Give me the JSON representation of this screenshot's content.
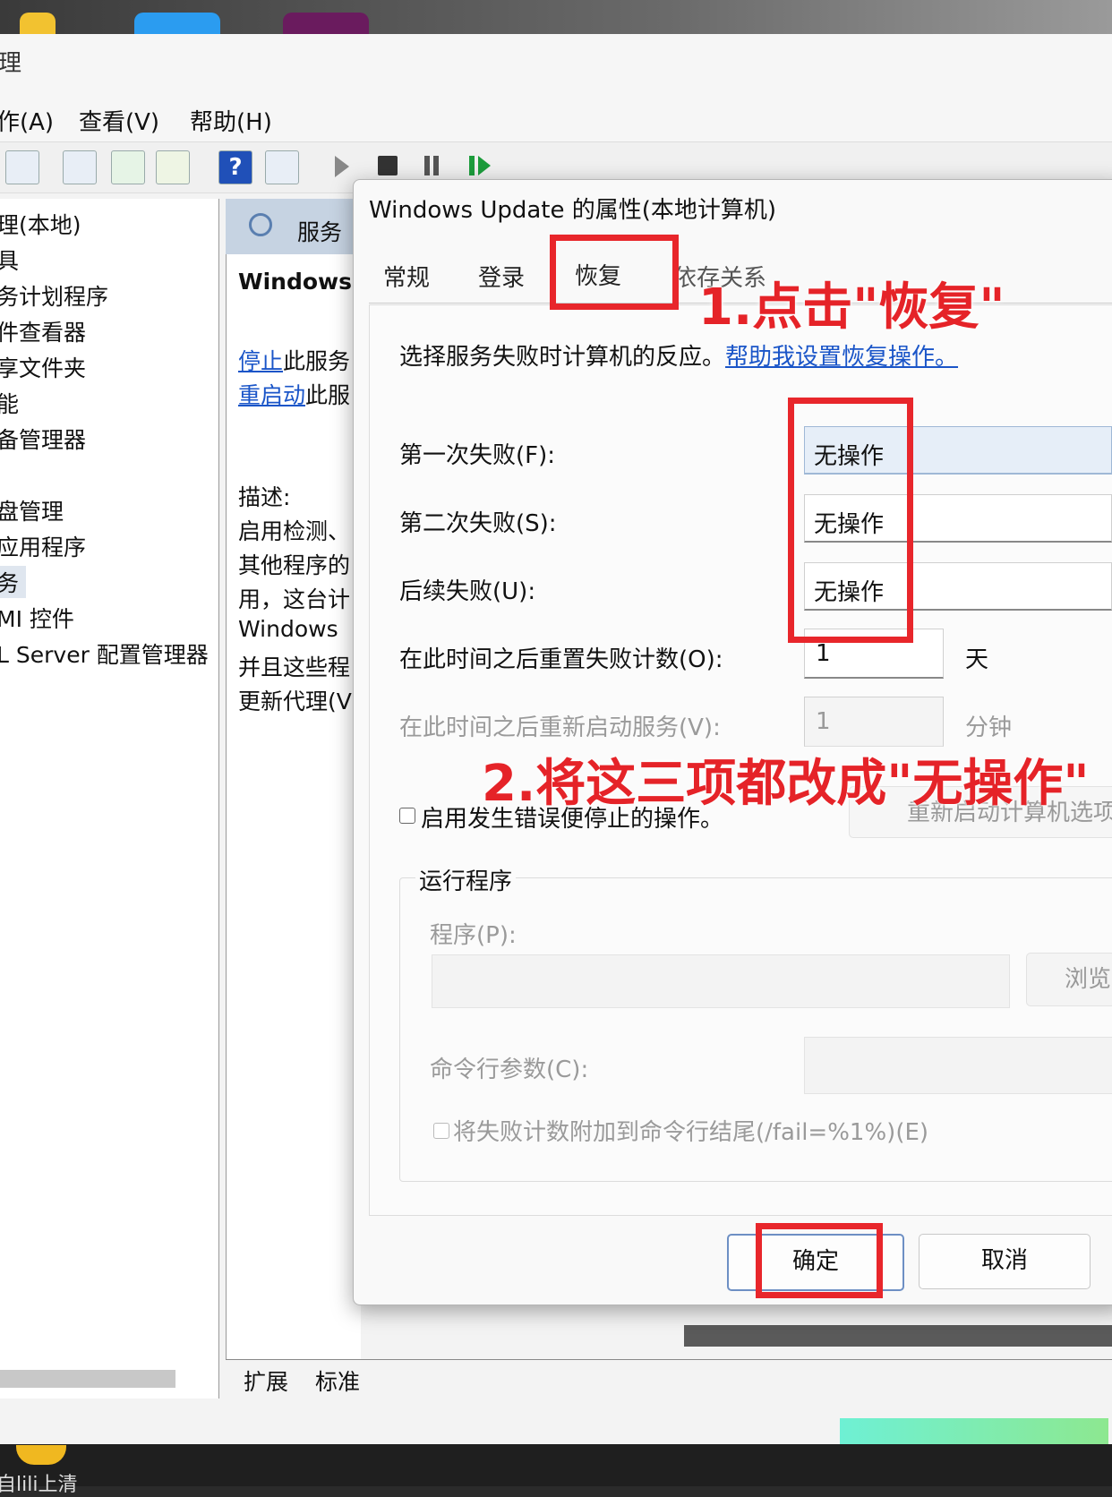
{
  "window": {
    "title_fragment": "理",
    "menu": [
      "作(A)",
      "查看(V)",
      "帮助(H)"
    ]
  },
  "tree": {
    "items": [
      "理(本地)",
      "具",
      "务计划程序",
      "件查看器",
      "享文件夹",
      "能",
      "备管理器",
      "盘管理",
      "应用程序",
      "务",
      "MI 控件",
      "L Server 配置管理器"
    ]
  },
  "middle": {
    "header": "服务",
    "service_name": "Windows",
    "stop_link": "停止",
    "stop_suffix": "此服务",
    "restart_link": "重启动",
    "restart_suffix": "此服",
    "desc_label": "描述:",
    "desc_lines": [
      "启用检测、",
      "其他程序的",
      "用，这台计",
      "Windows",
      "并且这些程",
      "更新代理(V"
    ],
    "bottom_tabs": [
      "扩展",
      "标准"
    ]
  },
  "dialog": {
    "title": "Windows Update 的属性(本地计算机)",
    "tabs": [
      "常规",
      "登录",
      "恢复",
      "依存关系"
    ],
    "intro_text": "选择服务失败时计算机的反应。",
    "help_link": "帮助我设置恢复操作。",
    "first_failure_label": "第一次失败(F):",
    "first_failure_value": "无操作",
    "second_failure_label": "第二次失败(S):",
    "second_failure_value": "无操作",
    "subsequent_failure_label": "后续失败(U):",
    "subsequent_failure_value": "无操作",
    "reset_label": "在此时间之后重置失败计数(O):",
    "reset_value": "1",
    "reset_unit": "天",
    "restart_label": "在此时间之后重新启动服务(V):",
    "restart_value": "1",
    "restart_unit": "分钟",
    "enable_stop_label": "启用发生错误便停止的操作。",
    "restart_options_button": "重新启动计算机选项",
    "run_program_group": "运行程序",
    "program_label": "程序(P):",
    "browse_button": "浏览",
    "cmdline_label": "命令行参数(C):",
    "append_fail_label": "将失败计数附加到命令行结尾(/fail=%1%)(E)",
    "ok_button": "确定",
    "cancel_button": "取消"
  },
  "annotations": {
    "step1": "1.点击\"恢复\"",
    "step2": "2.将这三项都改成\"无操作\"",
    "color": "#e8262b"
  },
  "taskbar": {
    "text": "自lili上清"
  }
}
